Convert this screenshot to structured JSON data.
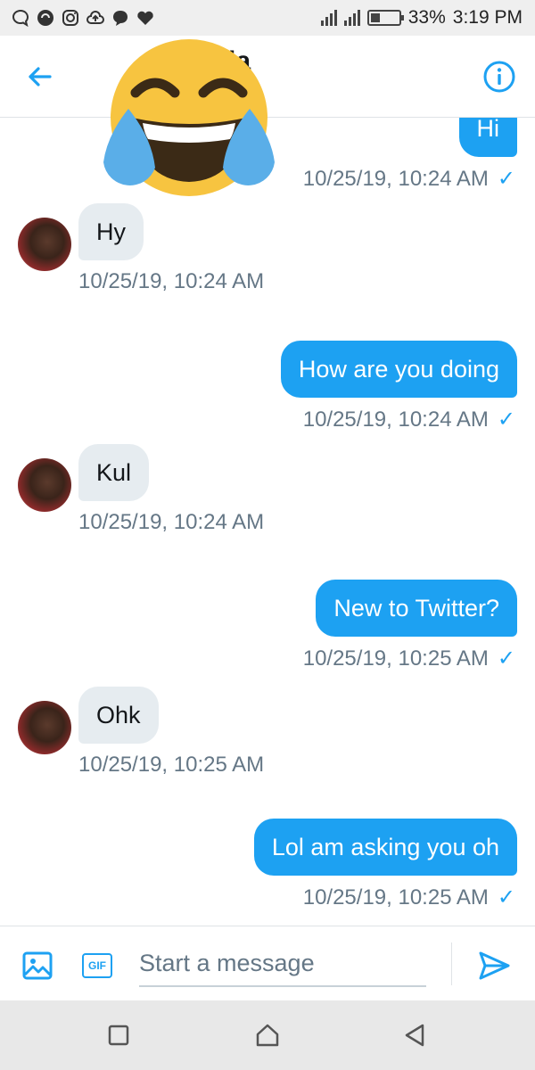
{
  "status_bar": {
    "battery_percent": "33%",
    "time": "3:19 PM",
    "battery_level": 0.33,
    "left_icons": [
      "chat-icon",
      "shield-icon",
      "instagram-icon",
      "cloud-upload-icon",
      "bubble-icon",
      "heart-icon"
    ]
  },
  "header": {
    "title_visible_fragment": "ia",
    "back_icon": "arrow-left-icon",
    "info_icon": "info-icon",
    "overlay": "crying-laughing-emoji"
  },
  "messages": [
    {
      "direction": "out",
      "text": "Hi",
      "timestamp": "10/25/19, 10:24 AM",
      "read": "✓"
    },
    {
      "direction": "in",
      "text": "Hy",
      "timestamp": "10/25/19, 10:24 AM"
    },
    {
      "direction": "out",
      "text": "How are you doing",
      "timestamp": "10/25/19, 10:24 AM",
      "read": "✓"
    },
    {
      "direction": "in",
      "text": "Kul",
      "timestamp": "10/25/19, 10:24 AM"
    },
    {
      "direction": "out",
      "text": "New to Twitter?",
      "timestamp": "10/25/19, 10:25 AM",
      "read": "✓"
    },
    {
      "direction": "in",
      "text": "Ohk",
      "timestamp": "10/25/19, 10:25 AM"
    },
    {
      "direction": "out",
      "text": "Lol am asking you oh",
      "timestamp": "10/25/19, 10:25 AM",
      "read": "✓"
    }
  ],
  "composer": {
    "gif_label": "GIF",
    "placeholder": "Start a message"
  },
  "colors": {
    "accent": "#1da1f2",
    "incoming_bubble": "#e6ecf0",
    "timestamp": "#657786"
  }
}
